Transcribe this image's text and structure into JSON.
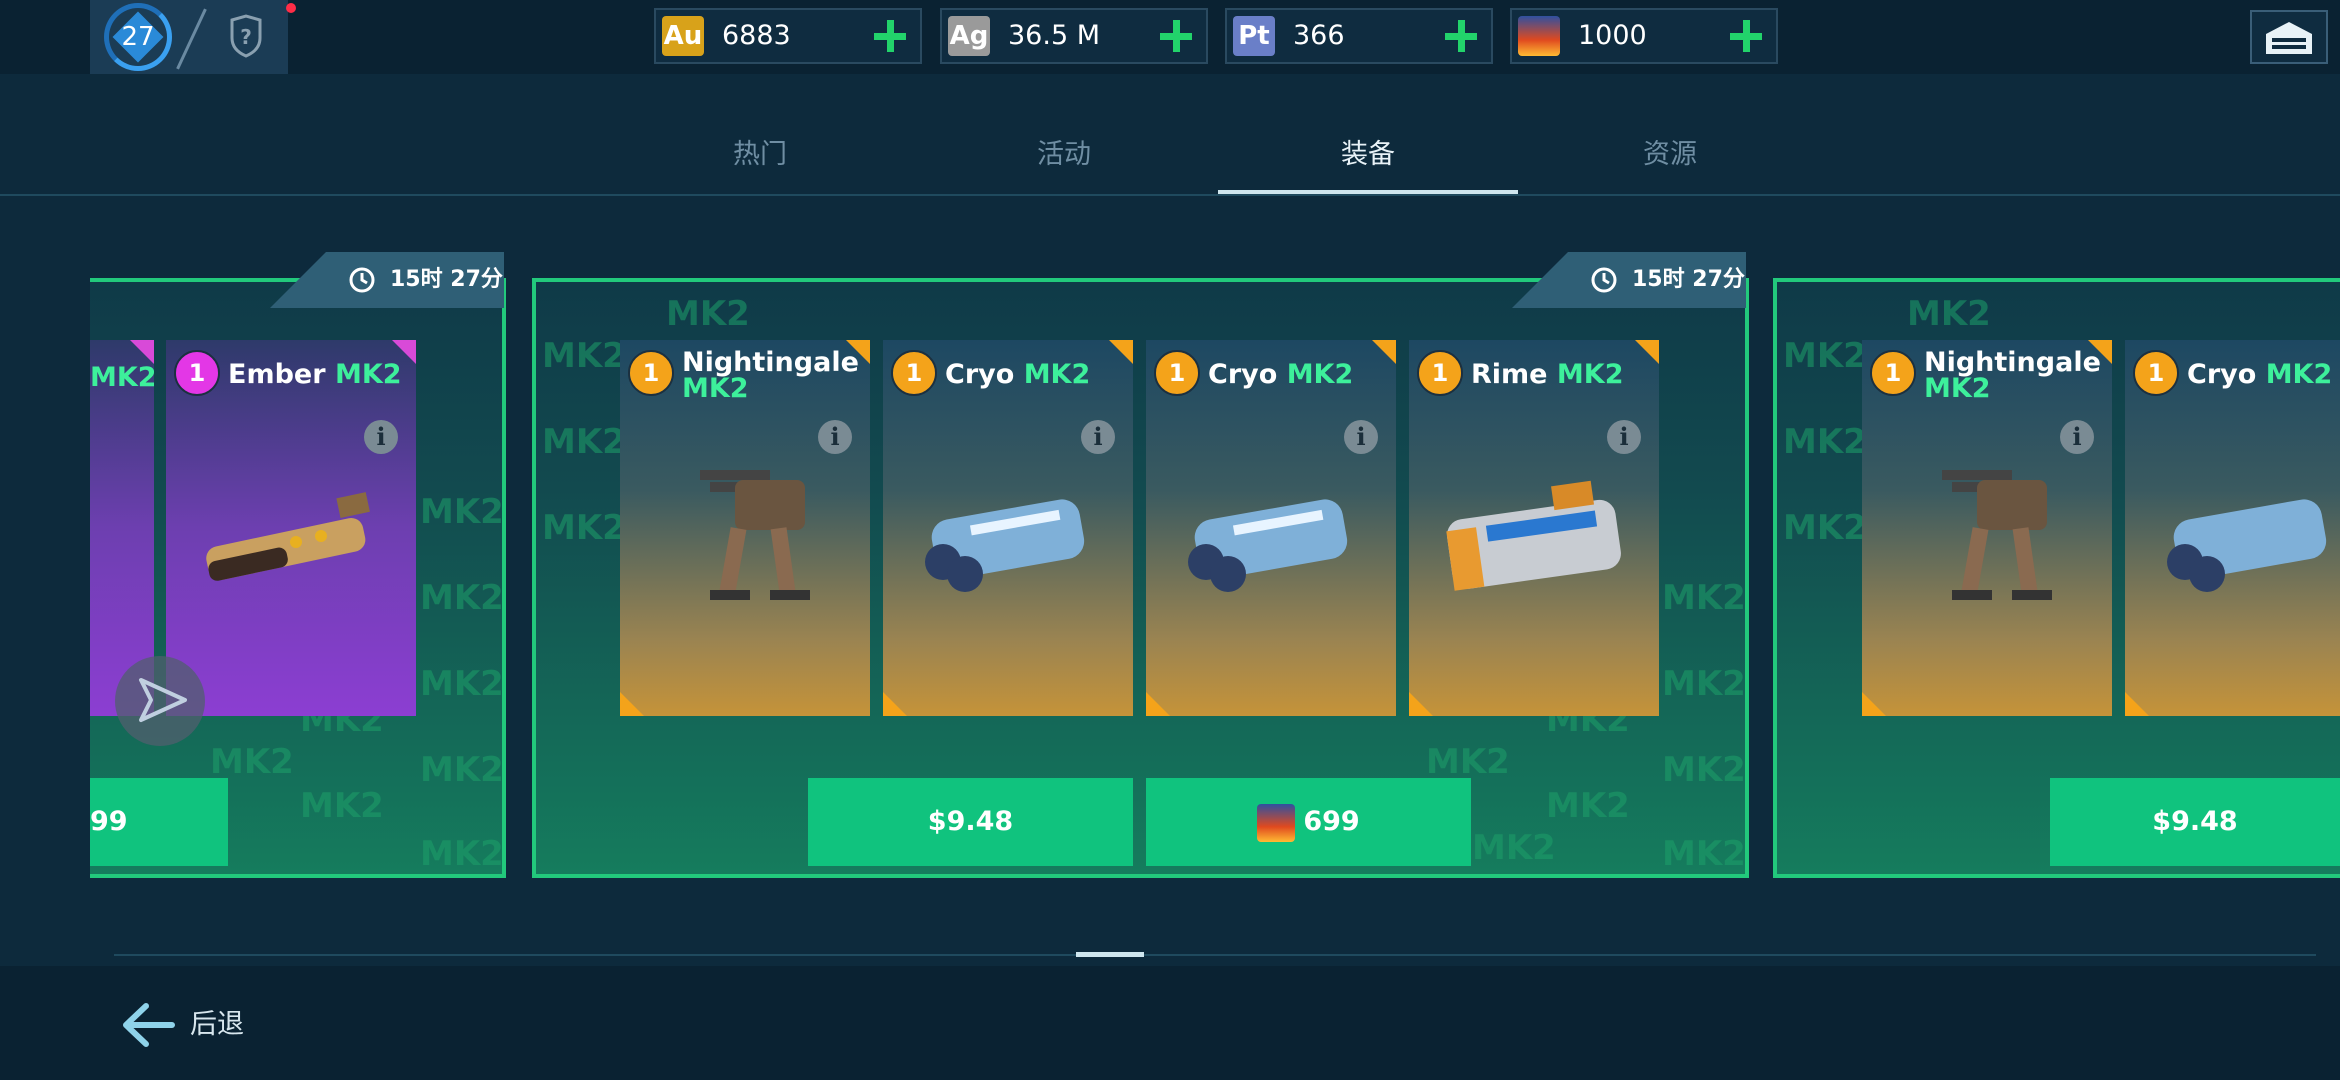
{
  "profile": {
    "level": "27"
  },
  "currencies": [
    {
      "icon_label": "Au",
      "value": "6883",
      "color": "#d8a21a"
    },
    {
      "icon_label": "Ag",
      "value": "36.5 M",
      "color": "#9a9a9a"
    },
    {
      "icon_label": "Pt",
      "value": "366",
      "color": "#6a7fc8"
    },
    {
      "icon_label": "",
      "value": "1000",
      "color": "#e05a1f"
    }
  ],
  "tabs": [
    {
      "label": "热门",
      "active": false
    },
    {
      "label": "活动",
      "active": false
    },
    {
      "label": "装备",
      "active": true
    },
    {
      "label": "资源",
      "active": false
    }
  ],
  "watermark": "MK2",
  "bundles": [
    {
      "timer": "15时 27分",
      "cards": [
        {
          "rank": "1",
          "name": "Ember",
          "mk": "MK2"
        }
      ],
      "price_partial": "99"
    },
    {
      "timer": "15时 27分",
      "cards": [
        {
          "rank": "1",
          "name": "Nightingale",
          "mk": "MK2"
        },
        {
          "rank": "1",
          "name": "Cryo",
          "mk": "MK2"
        },
        {
          "rank": "1",
          "name": "Cryo",
          "mk": "MK2"
        },
        {
          "rank": "1",
          "name": "Rime",
          "mk": "MK2"
        }
      ],
      "prices": [
        "$9.48",
        "699"
      ]
    },
    {
      "cards": [
        {
          "rank": "1",
          "name": "Nightingale",
          "mk": "MK2"
        },
        {
          "rank": "1",
          "name": "Cryo",
          "mk": "MK2"
        }
      ],
      "prices": [
        "$9.48"
      ]
    }
  ],
  "footer": {
    "back_label": "后退"
  }
}
